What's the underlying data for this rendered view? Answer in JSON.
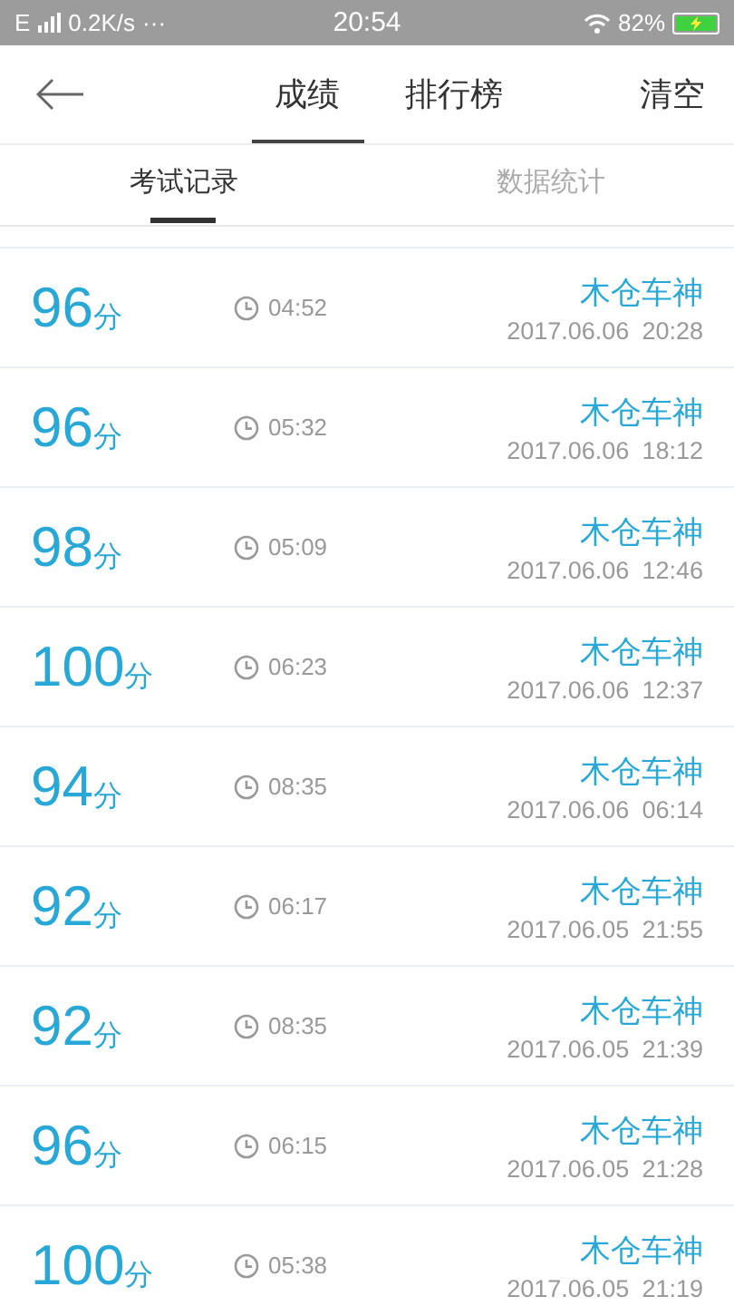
{
  "status_bar": {
    "network": "E",
    "speed": "0.2K/s",
    "more": "···",
    "time": "20:54",
    "battery": "82%",
    "charging": true
  },
  "header": {
    "tabs": [
      {
        "label": "成绩",
        "selected": true
      },
      {
        "label": "排行榜",
        "selected": false
      }
    ],
    "action": "清空"
  },
  "subtabs": [
    {
      "label": "考试记录",
      "selected": true
    },
    {
      "label": "数据统计",
      "selected": false
    }
  ],
  "records": [
    {
      "score": "96",
      "unit": "分",
      "duration": "04:52",
      "name": "木仓车神",
      "date": "2017.06.06",
      "time": "20:28"
    },
    {
      "score": "96",
      "unit": "分",
      "duration": "05:32",
      "name": "木仓车神",
      "date": "2017.06.06",
      "time": "18:12"
    },
    {
      "score": "98",
      "unit": "分",
      "duration": "05:09",
      "name": "木仓车神",
      "date": "2017.06.06",
      "time": "12:46"
    },
    {
      "score": "100",
      "unit": "分",
      "duration": "06:23",
      "name": "木仓车神",
      "date": "2017.06.06",
      "time": "12:37"
    },
    {
      "score": "94",
      "unit": "分",
      "duration": "08:35",
      "name": "木仓车神",
      "date": "2017.06.06",
      "time": "06:14"
    },
    {
      "score": "92",
      "unit": "分",
      "duration": "06:17",
      "name": "木仓车神",
      "date": "2017.06.05",
      "time": "21:55"
    },
    {
      "score": "92",
      "unit": "分",
      "duration": "08:35",
      "name": "木仓车神",
      "date": "2017.06.05",
      "time": "21:39"
    },
    {
      "score": "96",
      "unit": "分",
      "duration": "06:15",
      "name": "木仓车神",
      "date": "2017.06.05",
      "time": "21:28"
    },
    {
      "score": "100",
      "unit": "分",
      "duration": "05:38",
      "name": "木仓车神",
      "date": "2017.06.05",
      "time": "21:19"
    }
  ]
}
